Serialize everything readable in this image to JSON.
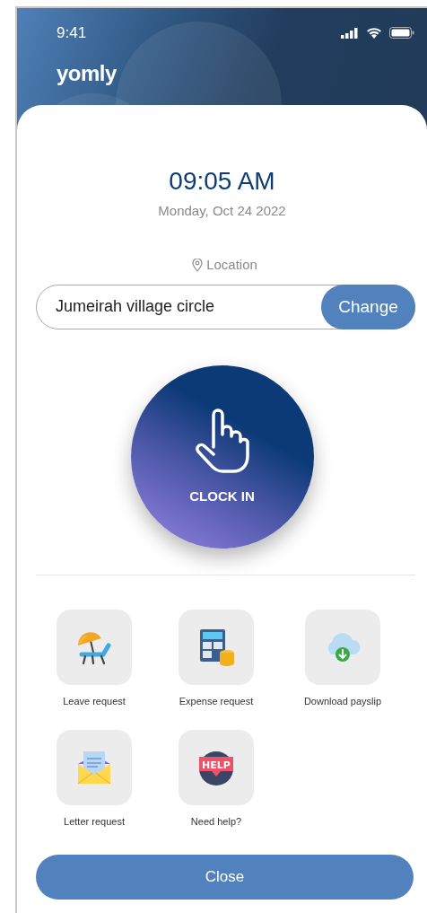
{
  "status_bar": {
    "time": "9:41"
  },
  "header": {
    "logo": "yomly"
  },
  "clock": {
    "time": "09:05 AM",
    "date": "Monday, Oct 24 2022"
  },
  "location": {
    "label": "Location",
    "value": "Jumeirah village circle",
    "change_button": "Change"
  },
  "clock_button": {
    "label": "CLOCK IN"
  },
  "actions": [
    {
      "kind": "leave",
      "label": "Leave request"
    },
    {
      "kind": "expense",
      "label": "Expense request"
    },
    {
      "kind": "payslip",
      "label": "Download payslip"
    },
    {
      "kind": "letter",
      "label": "Letter request"
    },
    {
      "kind": "help",
      "label": "Need help?",
      "icon_text": "HELP"
    }
  ],
  "close_button": "Close"
}
